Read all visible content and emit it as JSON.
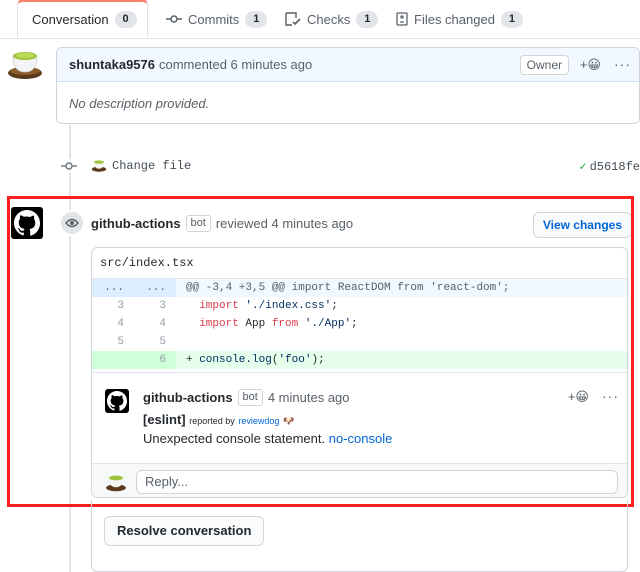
{
  "tabs": [
    {
      "label": "Conversation",
      "count": "0",
      "icon": "comment-discussion-icon"
    },
    {
      "label": "Commits",
      "count": "1",
      "icon": "git-commit-icon"
    },
    {
      "label": "Checks",
      "count": "1",
      "icon": "checklist-icon"
    },
    {
      "label": "Files changed",
      "count": "1",
      "icon": "file-diff-icon"
    }
  ],
  "comment": {
    "author": "shuntaka9576",
    "action": "commented 6 minutes ago",
    "badge": "Owner",
    "react": "+😀",
    "more": "···",
    "body": "No description provided."
  },
  "commit": {
    "message": "Change file",
    "sha": "d5618fe",
    "check": "✓"
  },
  "review": {
    "author": "github-actions",
    "bot_label": "bot",
    "action": "reviewed 4 minutes ago",
    "view_changes": "View changes",
    "file": "src/index.tsx",
    "hunk": {
      "old": "...",
      "new": "...",
      "text": "@@ -3,4 +3,5 @@ import ReactDOM from 'react-dom';"
    },
    "lines": [
      {
        "old": "3",
        "new": "3",
        "kw": "import",
        "str": " './index.css'",
        "rest": ";"
      },
      {
        "old": "4",
        "new": "4",
        "kw": "import",
        "mid": " App ",
        "kw2": "from",
        "str": " './App'",
        "rest": ";"
      },
      {
        "old": "5",
        "new": "5"
      }
    ],
    "added": {
      "new": "6",
      "prefix": "+ ",
      "obj": "console",
      "dot": ".",
      "fn": "log",
      "open": "(",
      "str": "'foo'",
      "close": ");"
    }
  },
  "inline_comment": {
    "author": "github-actions",
    "bot_label": "bot",
    "time": "4 minutes ago",
    "react": "+😀",
    "more": "···",
    "tag": "[eslint]",
    "reported_by": "reported by",
    "reporter": "reviewdog",
    "reporter_emoji": "🐶",
    "message": "Unexpected console statement.",
    "rule": "no-console"
  },
  "reply_placeholder": "Reply...",
  "resolve_label": "Resolve conversation",
  "colors": {
    "highlight": "#ff1f1f",
    "link": "#0366d6",
    "success": "#28a745"
  }
}
